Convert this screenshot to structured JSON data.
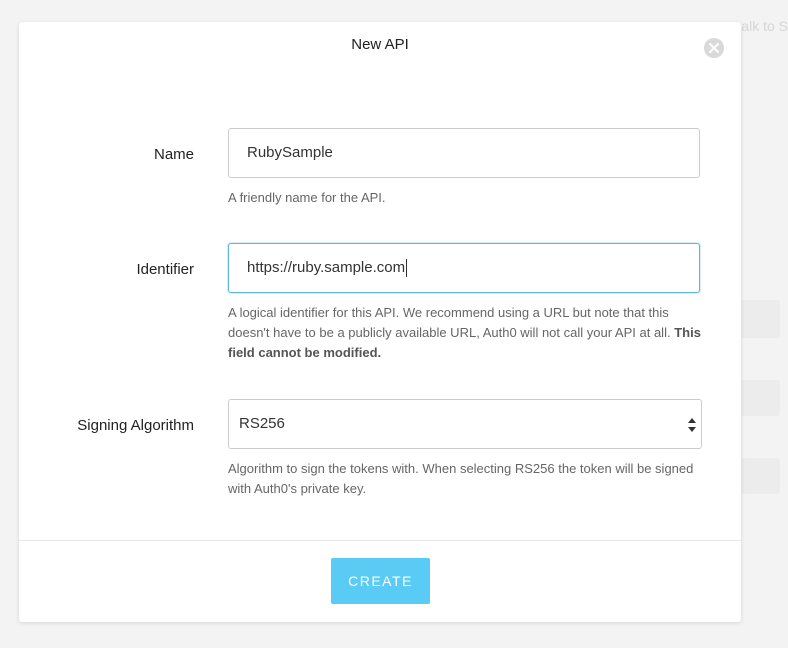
{
  "modal": {
    "title": "New API",
    "close_icon": "close-icon"
  },
  "form": {
    "name": {
      "label": "Name",
      "value": "RubySample",
      "help": "A friendly name for the API."
    },
    "identifier": {
      "label": "Identifier",
      "value": "https://ruby.sample.com",
      "help": "A logical identifier for this API. We recommend using a URL but note that this doesn't have to be a publicly available URL, Auth0 will not call your API at all.",
      "help_bold": "This field cannot be modified."
    },
    "signing_algorithm": {
      "label": "Signing Algorithm",
      "selected": "RS256",
      "help": "Algorithm to sign the tokens with. When selecting RS256 the token will be signed with Auth0's private key."
    }
  },
  "footer": {
    "create_label": "CREATE"
  },
  "colors": {
    "accent": "#5acbf4",
    "focus_border": "#5cb8e6"
  }
}
